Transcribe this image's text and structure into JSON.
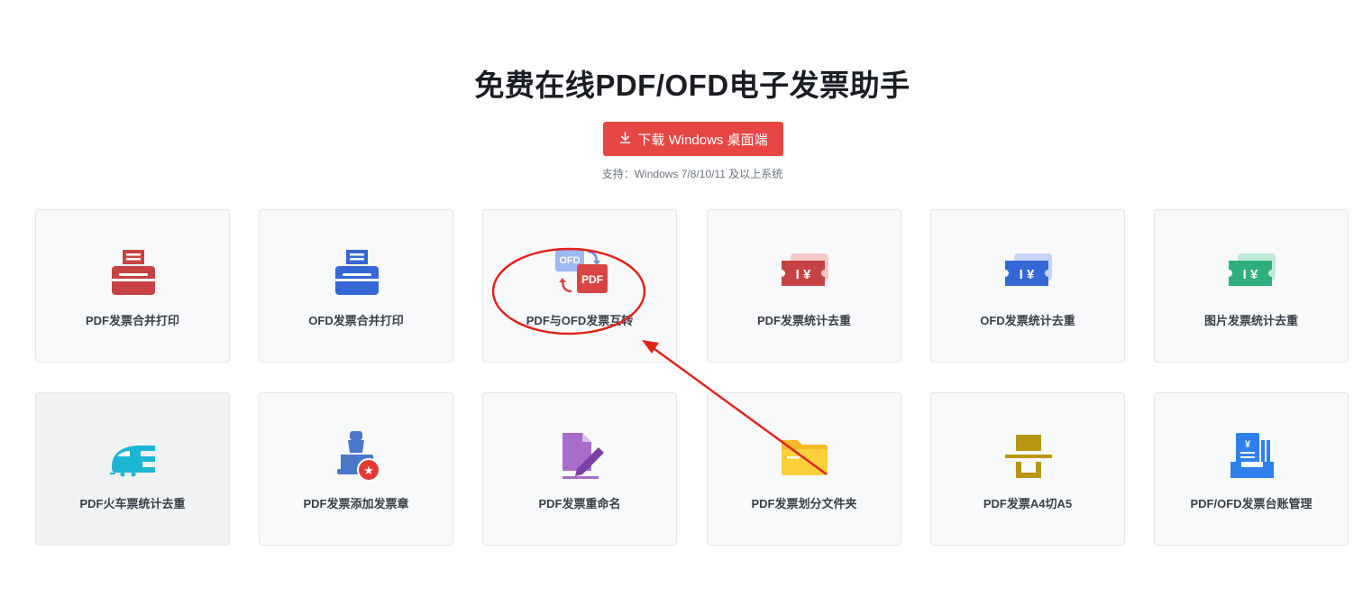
{
  "header": {
    "title": "免费在线PDF/OFD电子发票助手",
    "download_label": "下载 Windows 桌面端",
    "support_text": "支持：Windows 7/8/10/11 及以上系统"
  },
  "tools": [
    {
      "label": "PDF发票合并打印",
      "icon": "printer-red-icon"
    },
    {
      "label": "OFD发票合并打印",
      "icon": "printer-blue-icon"
    },
    {
      "label": "PDF与OFD发票互转",
      "icon": "ofd-pdf-convert-icon",
      "ofd_text": "OFD",
      "pdf_text": "PDF"
    },
    {
      "label": "PDF发票统计去重",
      "icon": "ticket-yen-red-icon",
      "glyph": "I ¥"
    },
    {
      "label": "OFD发票统计去重",
      "icon": "ticket-yen-blue-icon",
      "glyph": "I ¥"
    },
    {
      "label": "图片发票统计去重",
      "icon": "ticket-yen-green-icon",
      "glyph": "I ¥"
    },
    {
      "label": "PDF火车票统计去重",
      "icon": "train-icon"
    },
    {
      "label": "PDF发票添加发票章",
      "icon": "stamp-icon",
      "glyph": "★"
    },
    {
      "label": "PDF发票重命名",
      "icon": "rename-edit-icon"
    },
    {
      "label": "PDF发票划分文件夹",
      "icon": "folder-icon"
    },
    {
      "label": "PDF发票A4切A5",
      "icon": "cut-a4-a5-icon"
    },
    {
      "label": "PDF/OFD发票台账管理",
      "icon": "ledger-icon",
      "glyph": "¥"
    }
  ],
  "colors": {
    "accent_red": "#e84545",
    "annotation_red": "#e0241b"
  }
}
